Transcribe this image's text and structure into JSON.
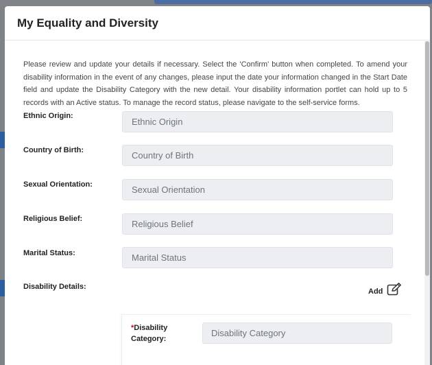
{
  "modal": {
    "title": "My Equality and Diversity"
  },
  "intro_text": "Please review and update your details if necessary. Select the 'Confirm' button when completed. To amend your disability information in the event of any changes, please input the date your information changed in the Start Date field and update the Disability Category with the new detail. Your disability information portlet can hold up to 5 records with an Active status. To manage the record status, please navigate to the self-service forms.",
  "fields": [
    {
      "label": "Ethnic Origin:",
      "placeholder": "Ethnic Origin"
    },
    {
      "label": "Country of Birth:",
      "placeholder": "Country of Birth"
    },
    {
      "label": "Sexual Orientation:",
      "placeholder": "Sexual Orientation"
    },
    {
      "label": "Religious Belief:",
      "placeholder": "Religious Belief"
    },
    {
      "label": "Marital Status:",
      "placeholder": "Marital Status"
    }
  ],
  "disability": {
    "label": "Disability Details:",
    "add_label": "Add",
    "add_icon": "edit-icon",
    "category_required_mark": "*",
    "category_label_line1": "Disability",
    "category_label_line2": "Category:",
    "category_placeholder": "Disability Category"
  },
  "colors": {
    "input_bg": "#eceef1",
    "required": "#d0021b",
    "overlay": "#7f8388"
  }
}
